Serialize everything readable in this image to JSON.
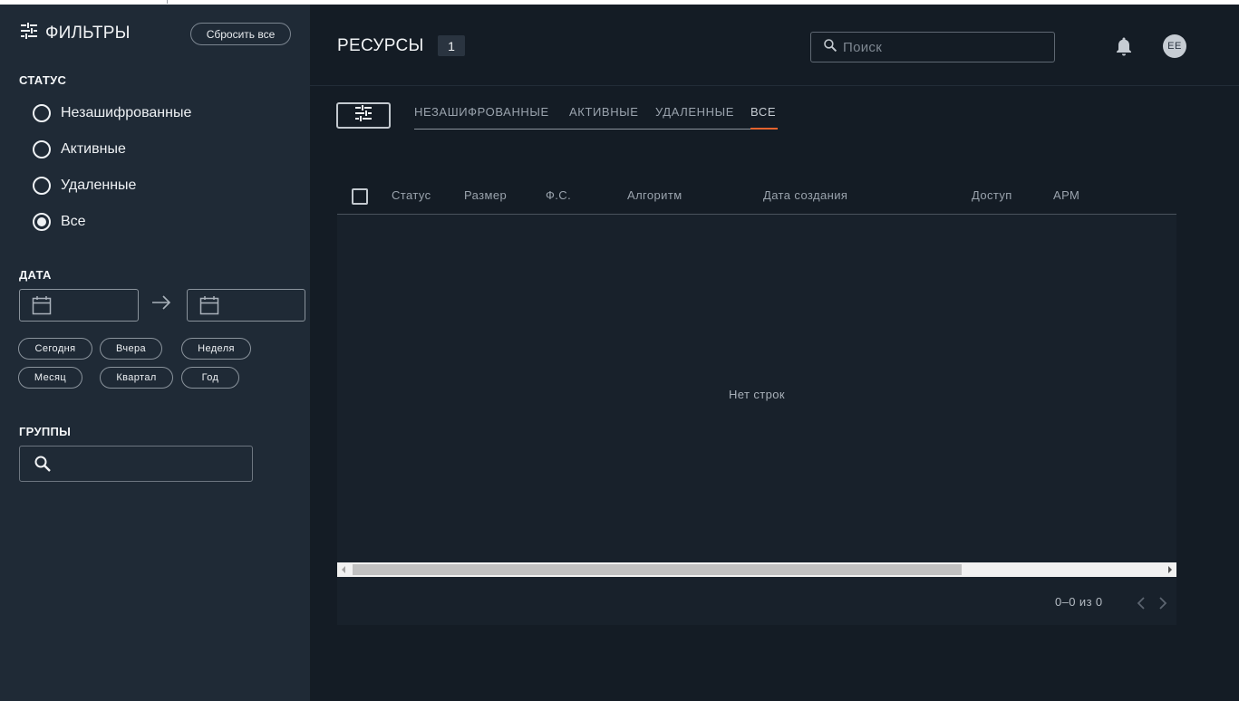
{
  "sidebar": {
    "title": "ФИЛЬТРЫ",
    "reset_label": "Сбросить все",
    "status_heading": "СТАТУС",
    "status_options": [
      {
        "label": "Незашифрованные",
        "selected": false
      },
      {
        "label": "Активные",
        "selected": false
      },
      {
        "label": "Удаленные",
        "selected": false
      },
      {
        "label": "Все",
        "selected": true
      }
    ],
    "date_heading": "ДАТА",
    "date_chips": [
      "Сегодня",
      "Вчера",
      "Неделя",
      "Месяц",
      "Квартал",
      "Год"
    ],
    "groups_heading": "ГРУППЫ"
  },
  "header": {
    "title": "РЕСУРСЫ",
    "count": "1",
    "search_placeholder": "Поиск",
    "avatar_initials": "EE"
  },
  "tabs": [
    {
      "label": "НЕЗАШИФРОВАННЫЕ",
      "active": false
    },
    {
      "label": "АКТИВНЫЕ",
      "active": false
    },
    {
      "label": "УДАЛЕННЫЕ",
      "active": false
    },
    {
      "label": "ВСЕ",
      "active": true
    }
  ],
  "table": {
    "columns": [
      "Статус",
      "Размер",
      "Ф.С.",
      "Алгоритм",
      "Дата создания",
      "Доступ",
      "АРМ"
    ],
    "empty_text": "Нет строк",
    "pagination": "0–0 из 0"
  },
  "colors": {
    "sidebar_bg": "#1f2a36",
    "main_bg": "#141c25",
    "accent": "#e4632e"
  }
}
